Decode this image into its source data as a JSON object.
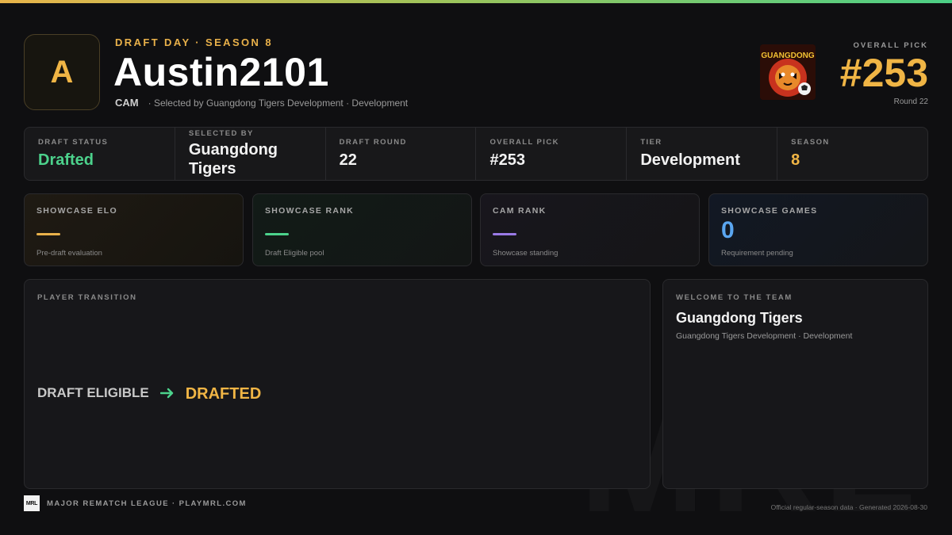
{
  "header": {
    "avatar_letter": "A",
    "kicker": "DRAFT DAY · SEASON 8",
    "player_name": "Austin2101",
    "position": "CAM",
    "selection_text": "· Selected by Guangdong Tigers Development · Development",
    "team_logo_text": "GUANGDONG",
    "overall_pick_label": "OVERALL PICK",
    "overall_pick": "#253",
    "round_text": "Round 22"
  },
  "stats": [
    {
      "label": "DRAFT STATUS",
      "value": "Drafted"
    },
    {
      "label": "SELECTED BY",
      "value": "Guangdong Tigers"
    },
    {
      "label": "DRAFT ROUND",
      "value": "22"
    },
    {
      "label": "OVERALL PICK",
      "value": "#253"
    },
    {
      "label": "TIER",
      "value": "Development"
    },
    {
      "label": "SEASON",
      "value": "8"
    }
  ],
  "cards": [
    {
      "label": "SHOWCASE ELO",
      "note": "Pre-draft evaluation",
      "accent": "#e9b14a"
    },
    {
      "label": "SHOWCASE RANK",
      "note": "Draft Eligible pool",
      "accent": "#4cd28c"
    },
    {
      "label": "CAM RANK",
      "note": "Showcase standing",
      "accent": "#9a7ae6"
    },
    {
      "label": "SHOWCASE GAMES",
      "value": "0",
      "note": "Requirement pending",
      "accent": "#5aa6f0"
    }
  ],
  "transition": {
    "label": "PLAYER TRANSITION",
    "from": "DRAFT ELIGIBLE",
    "to": "DRAFTED"
  },
  "welcome": {
    "label": "WELCOME TO THE TEAM",
    "team": "Guangdong Tigers",
    "sub": "Guangdong Tigers Development · Development"
  },
  "footer": {
    "logo_text": "MRL",
    "league": "MAJOR REMATCH LEAGUE · PLAYMRL.COM",
    "generated": "Official regular-season data · Generated 2026-08-30"
  },
  "watermark": "MRL",
  "colors": {
    "gold": "#f0b545",
    "green": "#4cd28c",
    "purple": "#9a7ae6",
    "blue": "#5aa6f0"
  }
}
